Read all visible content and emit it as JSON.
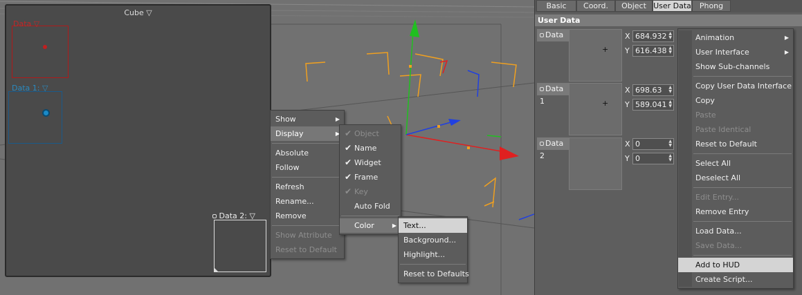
{
  "hud": {
    "title": "Cube",
    "labels": {
      "data": "Data",
      "data1": "Data 1:",
      "data2": "Data 2:"
    }
  },
  "context_menu": {
    "items": [
      {
        "label": "Show",
        "submenu": true,
        "enabled": true
      },
      {
        "label": "Display",
        "submenu": true,
        "enabled": true,
        "highlighted": true
      },
      {
        "label": "Absolute",
        "enabled": true
      },
      {
        "label": "Follow",
        "enabled": true
      },
      {
        "label": "Refresh",
        "enabled": true
      },
      {
        "label": "Rename...",
        "enabled": true
      },
      {
        "label": "Remove",
        "enabled": true
      },
      {
        "label": "Show Attribute",
        "enabled": false
      },
      {
        "label": "Reset to Default",
        "enabled": false
      }
    ]
  },
  "display_menu": {
    "items": [
      {
        "label": "Object",
        "checked": true,
        "enabled": false
      },
      {
        "label": "Name",
        "checked": true,
        "enabled": true
      },
      {
        "label": "Widget",
        "checked": true,
        "enabled": true
      },
      {
        "label": "Frame",
        "checked": true,
        "enabled": true
      },
      {
        "label": "Key",
        "checked": true,
        "enabled": false
      },
      {
        "label": "Auto Fold",
        "checked": false,
        "enabled": true
      },
      {
        "label": "Color",
        "submenu": true,
        "enabled": true,
        "highlighted": true
      }
    ]
  },
  "color_menu": {
    "items": [
      {
        "label": "Text...",
        "highlighted": true
      },
      {
        "label": "Background..."
      },
      {
        "label": "Highlight..."
      },
      {
        "label": "Reset to Defaults"
      }
    ]
  },
  "tabs": [
    {
      "label": "Basic",
      "active": false
    },
    {
      "label": "Coord.",
      "active": false
    },
    {
      "label": "Object",
      "active": false
    },
    {
      "label": "User Data",
      "active": true
    },
    {
      "label": "Phong",
      "active": false
    }
  ],
  "user_data": {
    "header": "User Data",
    "entries": [
      {
        "label": "Data",
        "x": "684.932",
        "y": "616.438"
      },
      {
        "label": "Data 1",
        "x": "698.63",
        "y": "589.041"
      },
      {
        "label": "Data 2",
        "x": "0",
        "y": "0"
      }
    ],
    "x_label": "X",
    "y_label": "Y"
  },
  "panel_menu": {
    "items": [
      {
        "label": "Animation",
        "submenu": true,
        "enabled": true
      },
      {
        "label": "User Interface",
        "submenu": true,
        "enabled": true
      },
      {
        "label": "Show Sub-channels",
        "enabled": true
      },
      {
        "label": "Copy User Data Interface",
        "enabled": true
      },
      {
        "label": "Copy",
        "enabled": true
      },
      {
        "label": "Paste",
        "enabled": false
      },
      {
        "label": "Paste Identical",
        "enabled": false
      },
      {
        "label": "Reset to Default",
        "enabled": true
      },
      {
        "label": "Select All",
        "enabled": true
      },
      {
        "label": "Deselect All",
        "enabled": true
      },
      {
        "label": "Edit Entry...",
        "enabled": false
      },
      {
        "label": "Remove Entry",
        "enabled": true
      },
      {
        "label": "Load Data...",
        "enabled": true
      },
      {
        "label": "Save Data...",
        "enabled": false
      },
      {
        "label": "Add to HUD",
        "enabled": true,
        "highlighted": true
      },
      {
        "label": "Create Script...",
        "enabled": true
      }
    ]
  },
  "colors": {
    "axis_x": "#e02020",
    "axis_y": "#20c020",
    "axis_z": "#2040e0",
    "bbox": "#f0a020"
  }
}
